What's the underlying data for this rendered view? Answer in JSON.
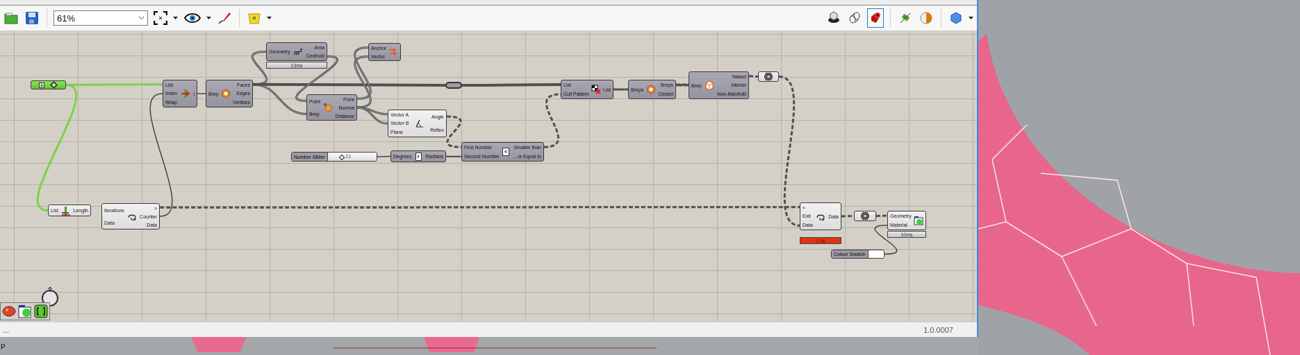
{
  "toolbar": {
    "zoom": "61%"
  },
  "preview_modes": [
    {
      "selected": false
    },
    {
      "selected": false
    },
    {
      "selected": true
    },
    {
      "selected": false
    },
    {
      "selected": false
    },
    {
      "selected": false
    }
  ],
  "nodes": [
    {
      "kind": "toggle"
    },
    {
      "kind": "dark",
      "inputs": [
        "List",
        "Index",
        "Wrap"
      ],
      "outputs": [
        "i"
      ]
    },
    {
      "kind": "dark",
      "inputs": [
        "Brep"
      ],
      "outputs": [
        "Faces",
        "Edges",
        "Vertices"
      ]
    },
    {
      "kind": "dark",
      "inputs": [
        "Geometry"
      ],
      "icon_label": "m$^{2}$",
      "outputs": [
        "Area",
        "Centroid"
      ],
      "timer": {
        "text": "13ms",
        "warning": false
      }
    },
    {
      "kind": "dark",
      "inputs": [
        "Point",
        "Brep"
      ],
      "outputs": [
        "Point",
        "Normal",
        "Distance"
      ]
    },
    {
      "kind": "dark",
      "inputs": [
        "Anchor",
        "Vector"
      ]
    },
    {
      "kind": "light",
      "inputs": [
        "Vector A",
        "Vector B",
        "Plane"
      ],
      "outputs": [
        "Angle",
        "Reflex"
      ]
    },
    {
      "kind": "slider",
      "label": "Number Slider",
      "value": "21",
      "level": 0.25
    },
    {
      "kind": "dark",
      "inputs": [
        "Degrees"
      ],
      "icon_label": "r",
      "outputs": [
        "Radians"
      ]
    },
    {
      "kind": "dark",
      "inputs": [
        "First Number",
        "Second Number"
      ],
      "icon_label": "<",
      "outputs": [
        "Smaller than",
        "... or Equal to"
      ]
    },
    {
      "kind": "relay"
    },
    {
      "kind": "dark",
      "inputs": [
        "List",
        "Cull Pattern"
      ],
      "outputs": [
        "List"
      ]
    },
    {
      "kind": "dark",
      "inputs": [
        "Breps"
      ],
      "outputs": [
        "Breps",
        "Closed"
      ]
    },
    {
      "kind": "dark",
      "inputs": [
        "Brep"
      ],
      "outputs": [
        "Naked",
        "Interior",
        "Non-Manifold"
      ]
    },
    {
      "kind": "dam"
    },
    {
      "kind": "light",
      "inputs": [
        "List"
      ],
      "outputs": [
        "Length"
      ]
    },
    {
      "kind": "light",
      "inputs": [
        "Iterations",
        "Data"
      ],
      "outputs": [
        ">",
        "Counter",
        "Data"
      ]
    },
    {
      "kind": "light",
      "inputs": [
        "<",
        "Exit",
        "Data"
      ],
      "outputs": [
        "Data"
      ],
      "timer": {
        "text": "1.6s",
        "warning": true
      }
    },
    {
      "kind": "dam"
    },
    {
      "kind": "light",
      "inputs": [
        "Geometry",
        "Material"
      ],
      "timer": {
        "text": "10ms",
        "warning": false
      }
    },
    {
      "kind": "swatch",
      "label": "Colour Swatch"
    }
  ],
  "status_bar": {
    "left": "...",
    "version": "1.0.0007"
  },
  "viewport_label": "P"
}
